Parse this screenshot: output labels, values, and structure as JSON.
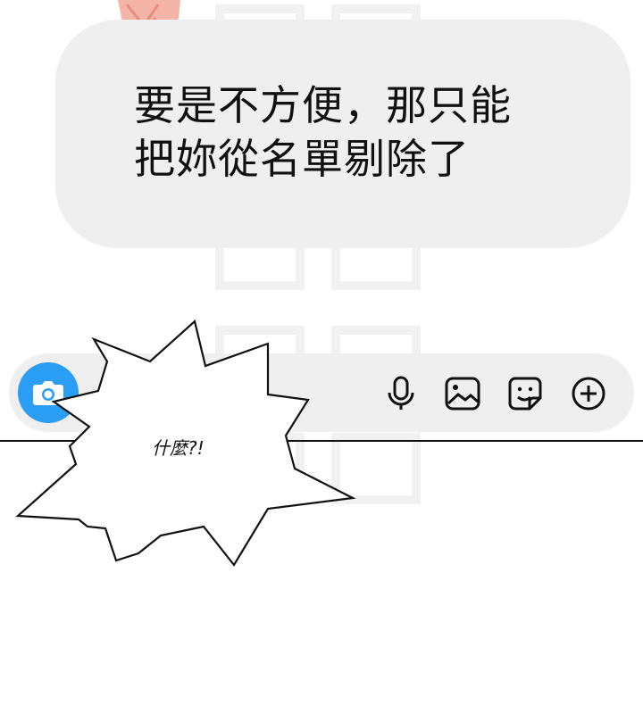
{
  "message": {
    "line1": "要是不方便，那只能",
    "line2": "把妳從名單剔除了"
  },
  "composer": {
    "icons": [
      "camera-icon",
      "microphone-icon",
      "image-icon",
      "sticker-icon",
      "plus-icon"
    ],
    "accent": "#2a9df4"
  },
  "exclamation": {
    "text": "什麼?!"
  }
}
